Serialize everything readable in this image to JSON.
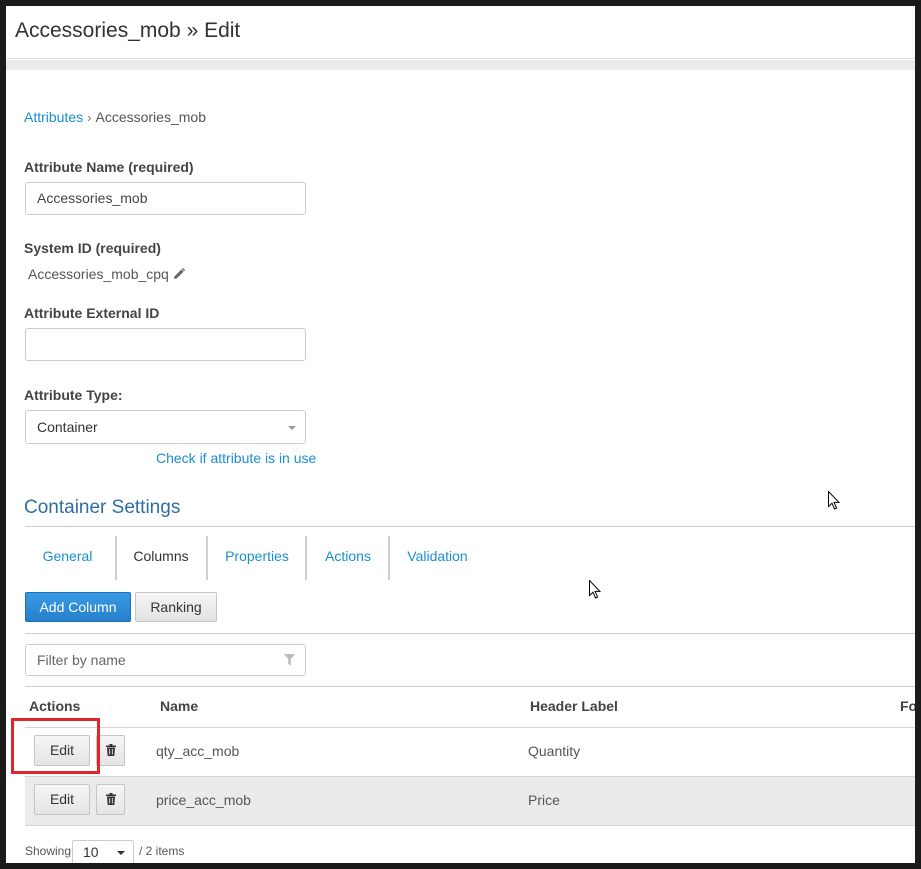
{
  "page": {
    "title": "Accessories_mob » Edit"
  },
  "breadcrumb": {
    "parent": "Attributes",
    "separator": "›",
    "current": "Accessories_mob"
  },
  "form": {
    "attribute_name": {
      "label": "Attribute Name (required)",
      "value": "Accessories_mob"
    },
    "system_id": {
      "label": "System ID (required)",
      "value": "Accessories_mob_cpq",
      "icon": "pencil-icon"
    },
    "external_id": {
      "label": "Attribute External ID",
      "value": ""
    },
    "attribute_type": {
      "label": "Attribute Type:",
      "value": "Container"
    },
    "check_link": "Check if attribute is in use"
  },
  "container_settings": {
    "title": "Container Settings",
    "tabs": [
      {
        "label": "General",
        "active": false
      },
      {
        "label": "Columns",
        "active": true
      },
      {
        "label": "Properties",
        "active": false
      },
      {
        "label": "Actions",
        "active": false
      },
      {
        "label": "Validation",
        "active": false
      }
    ],
    "add_column_label": "Add Column",
    "ranking_label": "Ranking",
    "filter_placeholder": "Filter by name",
    "table": {
      "headers": [
        "Actions",
        "Name",
        "Header Label",
        "Fo"
      ],
      "rows": [
        {
          "edit": "Edit",
          "name": "qty_acc_mob",
          "header_label": "Quantity"
        },
        {
          "edit": "Edit",
          "name": "price_acc_mob",
          "header_label": "Price"
        }
      ]
    },
    "pager": {
      "showing_label": "Showing",
      "page_size": "10",
      "total": "/ 2 items"
    }
  },
  "colors": {
    "link": "#1a8fd1",
    "primary_button": "#2780cc",
    "section_title": "#2f6ea5",
    "highlight": "#e0252b"
  }
}
